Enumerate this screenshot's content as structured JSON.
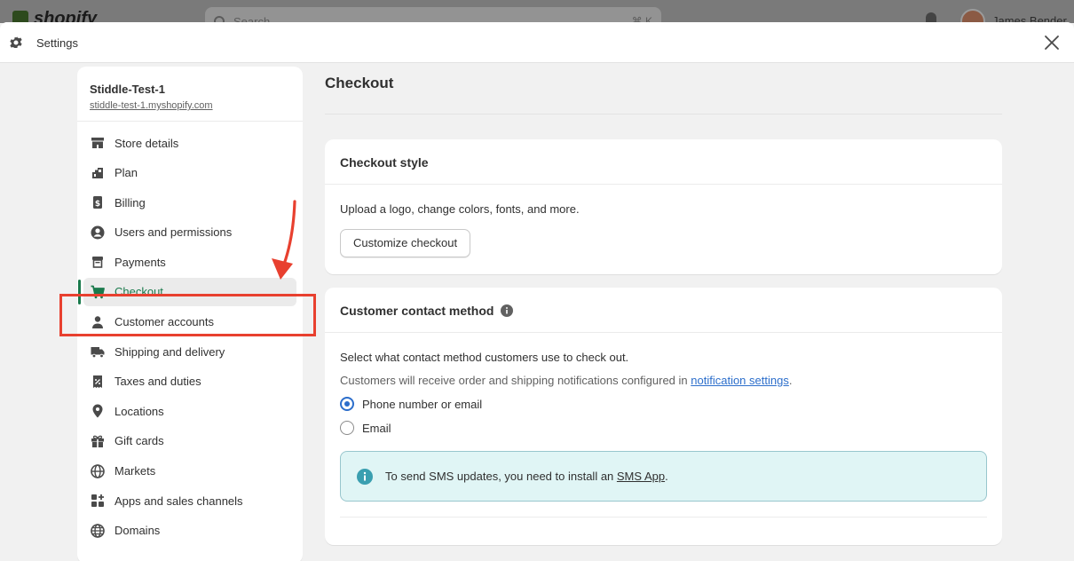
{
  "background": {
    "logo_text": "shopify",
    "search_placeholder": "Search",
    "search_shortcut": "⌘ K",
    "user_name": "James Bender"
  },
  "modal": {
    "title": "Settings"
  },
  "sidebar": {
    "store_name": "Stiddle-Test-1",
    "store_url": "stiddle-test-1.myshopify.com",
    "items": [
      {
        "label": "Store details",
        "icon": "store-icon"
      },
      {
        "label": "Plan",
        "icon": "plan-icon"
      },
      {
        "label": "Billing",
        "icon": "billing-icon"
      },
      {
        "label": "Users and permissions",
        "icon": "user-circle-icon"
      },
      {
        "label": "Payments",
        "icon": "payments-icon"
      },
      {
        "label": "Checkout",
        "icon": "cart-icon",
        "active": true
      },
      {
        "label": "Customer accounts",
        "icon": "person-icon"
      },
      {
        "label": "Shipping and delivery",
        "icon": "truck-icon"
      },
      {
        "label": "Taxes and duties",
        "icon": "tax-receipt-icon"
      },
      {
        "label": "Locations",
        "icon": "location-pin-icon"
      },
      {
        "label": "Gift cards",
        "icon": "gift-icon"
      },
      {
        "label": "Markets",
        "icon": "globe-icon"
      },
      {
        "label": "Apps and sales channels",
        "icon": "apps-icon"
      },
      {
        "label": "Domains",
        "icon": "domain-globe-icon"
      }
    ]
  },
  "main": {
    "page_title": "Checkout",
    "checkout_style": {
      "heading": "Checkout style",
      "description": "Upload a logo, change colors, fonts, and more.",
      "button_label": "Customize checkout"
    },
    "contact_method": {
      "heading": "Customer contact method",
      "description": "Select what contact method customers use to check out.",
      "note_prefix": "Customers will receive order and shipping notifications configured in ",
      "note_link": "notification settings",
      "note_suffix": ".",
      "options": [
        {
          "label": "Phone number or email",
          "checked": true
        },
        {
          "label": "Email",
          "checked": false
        }
      ],
      "banner_prefix": "To send SMS updates, you need to install an ",
      "banner_link": "SMS App",
      "banner_suffix": "."
    }
  },
  "colors": {
    "accent_green": "#1a7a4c",
    "link_blue": "#2c6ecb",
    "annotation_red": "#e8402f",
    "banner_bg": "#e0f5f5"
  }
}
